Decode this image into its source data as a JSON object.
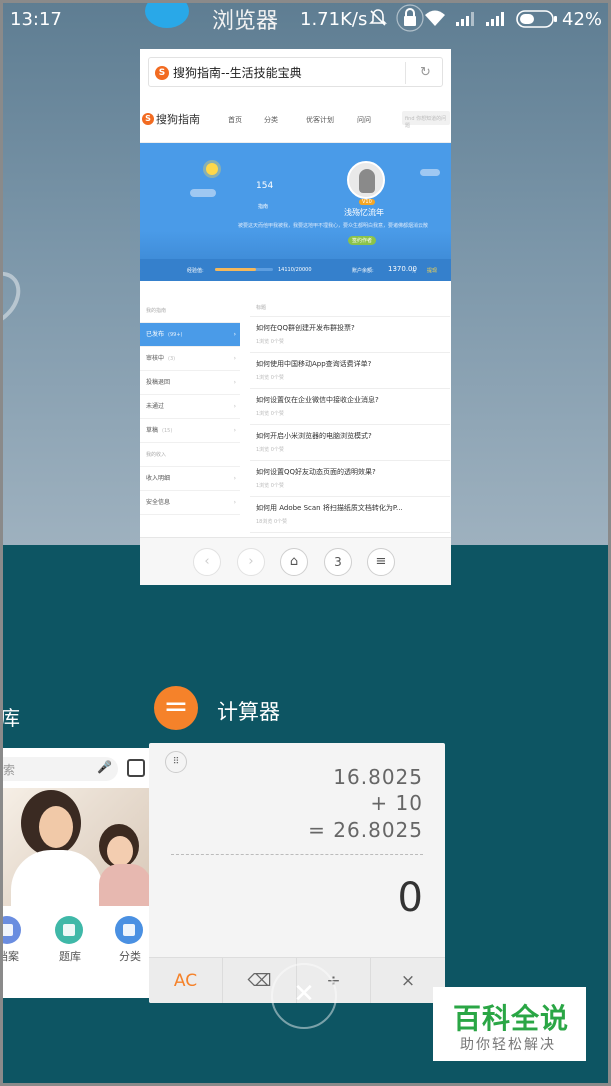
{
  "status_bar": {
    "time": "13:17",
    "speed": "1.71K/s",
    "battery": "42%"
  },
  "browser_app": {
    "title": "浏览器",
    "url_title": "搜狗指南--生活技能宝典",
    "site_name": "搜狗指南",
    "nav": [
      "首页",
      "分类",
      "优客计划",
      "问问"
    ],
    "search_placeholder": "find 你想知道的问题",
    "profile": {
      "stat_value": "154",
      "stat_label": "指南",
      "level": "V10",
      "username": "浅殇忆流年",
      "motto": "被要这天而他甲我被我，我要这地甲不埋我心，要众生都明白我意，要诸佛都烟消云散",
      "tag": "签约作者",
      "exp_label": "经验值:",
      "exp_value": "14110/20000",
      "exp_fraction": 0.7,
      "balance_label": "账户余额:",
      "balance_amount": "1370.00",
      "balance_unit": "元",
      "withdraw": "提现"
    },
    "menu": [
      {
        "label": "我的指南",
        "count": "",
        "type": "section"
      },
      {
        "label": "已发布",
        "count": "(99+)",
        "type": "active"
      },
      {
        "label": "审核中",
        "count": "(3)",
        "type": "item"
      },
      {
        "label": "投稿退回",
        "count": "",
        "type": "item"
      },
      {
        "label": "未通过",
        "count": "",
        "type": "item"
      },
      {
        "label": "草稿",
        "count": "(15)",
        "type": "item"
      },
      {
        "label": "我的收入",
        "count": "",
        "type": "section"
      },
      {
        "label": "收入明细",
        "count": "",
        "type": "item"
      },
      {
        "label": "安全信息",
        "count": "",
        "type": "item"
      }
    ],
    "articles_header": "标题",
    "articles": [
      {
        "title": "如何在QQ群创建开发布群投票?",
        "views": "1浏览",
        "likes": "0个赞"
      },
      {
        "title": "如何使用中国移动App查询话费详单?",
        "views": "1浏览",
        "likes": "0个赞"
      },
      {
        "title": "如何设置仅在企业微信中接收企业消息?",
        "views": "1浏览",
        "likes": "0个赞"
      },
      {
        "title": "如何开启小米浏览器的电脑浏览模式?",
        "views": "1浏览",
        "likes": "0个赞"
      },
      {
        "title": "如何设置QQ好友动态页面的透明效果?",
        "views": "1浏览",
        "likes": "0个赞"
      },
      {
        "title": "如何用 Adobe Scan 将扫描纸质文档转化为P...",
        "views": "18浏览",
        "likes": "0个赞"
      }
    ],
    "tab_count": "3"
  },
  "calculator_app": {
    "title": "计算器",
    "line1": "16.8025",
    "line2": "+ 10",
    "line3": "= 26.8025",
    "result": "0",
    "keys": [
      "AC",
      "⌫",
      "÷",
      "×"
    ]
  },
  "left_app": {
    "title_fragment": "库",
    "search_fragment": "索",
    "icons": [
      {
        "label": "档案",
        "color": "#6a8de0"
      },
      {
        "label": "题库",
        "color": "#3fb8a8"
      },
      {
        "label": "分类",
        "color": "#4a90e2"
      }
    ]
  },
  "watermark": {
    "main": "百科全说",
    "sub": "助你轻松解决"
  },
  "colors": {
    "browser_blue": "#4a9be8",
    "calc_orange": "#f5822a",
    "brand_green": "#2aa645"
  }
}
